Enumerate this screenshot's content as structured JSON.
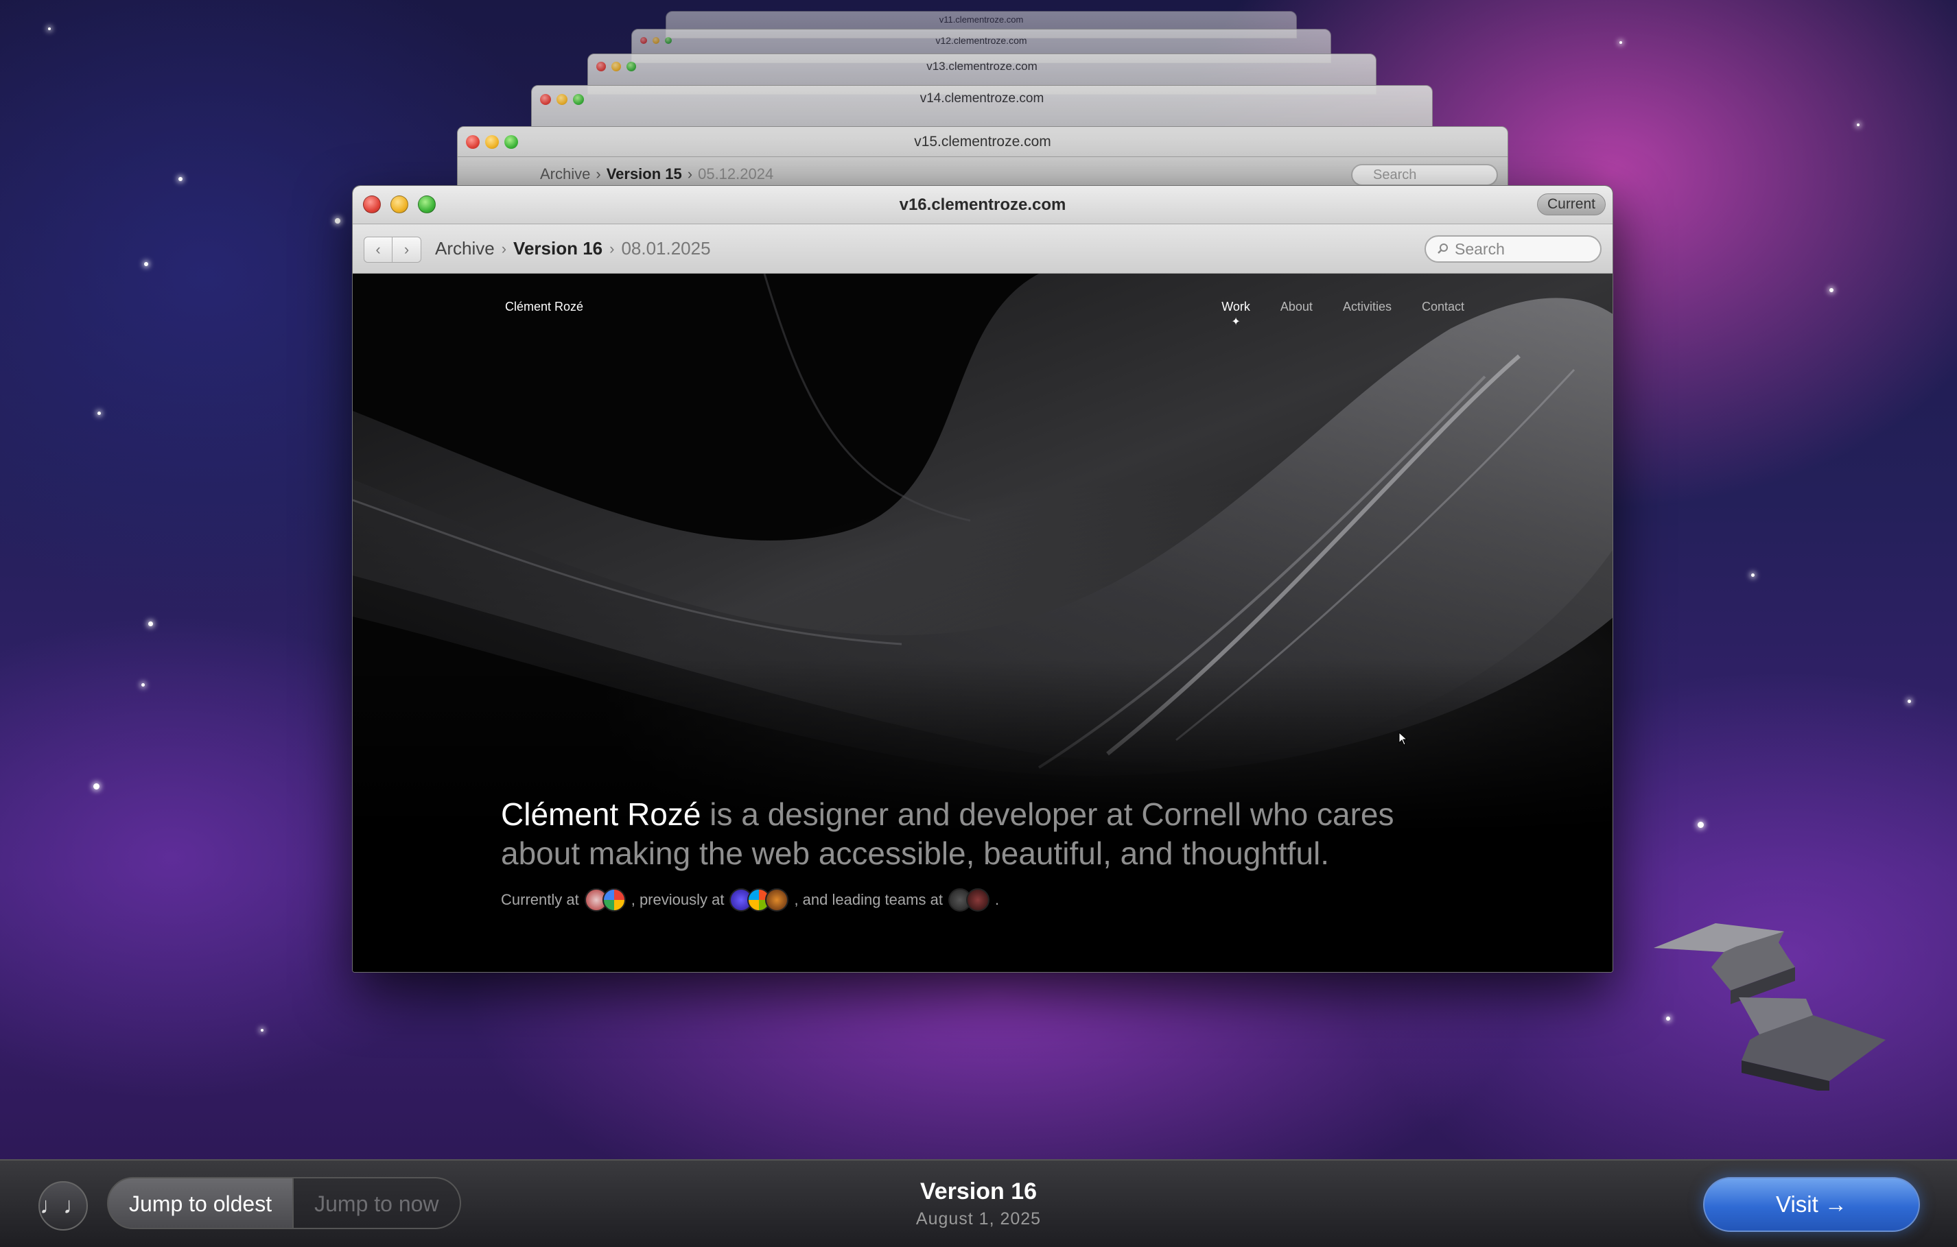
{
  "stack": {
    "windows": [
      {
        "title": "v11.clementroze.com"
      },
      {
        "title": "v12.clementroze.com"
      },
      {
        "title": "v13.clementroze.com"
      },
      {
        "title": "v14.clementroze.com"
      },
      {
        "title": "v15.clementroze.com",
        "crumb_archive": "Archive",
        "crumb_version": "Version 15",
        "crumb_date": "05.12.2024",
        "search_placeholder": "Search"
      }
    ]
  },
  "window": {
    "title": "v16.clementroze.com",
    "badge": "Current",
    "back_glyph": "‹",
    "forward_glyph": "›",
    "breadcrumb": {
      "archive": "Archive",
      "version": "Version 16",
      "date": "08.01.2025",
      "separator": "›"
    },
    "search_placeholder": "Search",
    "search_icon": "magnifier-icon"
  },
  "site": {
    "brand": "Clément Rozé",
    "nav": [
      "Work",
      "About",
      "Activities",
      "Contact"
    ],
    "active_nav": "Work",
    "hero_name": "Clément Rozé",
    "hero_rest": " is a designer and developer at Cornell who cares about making the web accessible, beautiful, and thoughtful.",
    "currently_at": "Currently at",
    "previously_at": ", previously at",
    "leading_teams": ", and leading teams at",
    "end_punct": "."
  },
  "bottom_bar": {
    "music_icon": "♩♩",
    "jump_oldest": "Jump to oldest",
    "jump_now": "Jump to now",
    "version": "Version 16",
    "date": "August 1, 2025",
    "visit": "Visit →"
  },
  "colors": {
    "accent_blue": "#2f6ad4",
    "traffic_red": "#e0443a",
    "traffic_yellow": "#f0b429",
    "traffic_green": "#3fb53a"
  }
}
